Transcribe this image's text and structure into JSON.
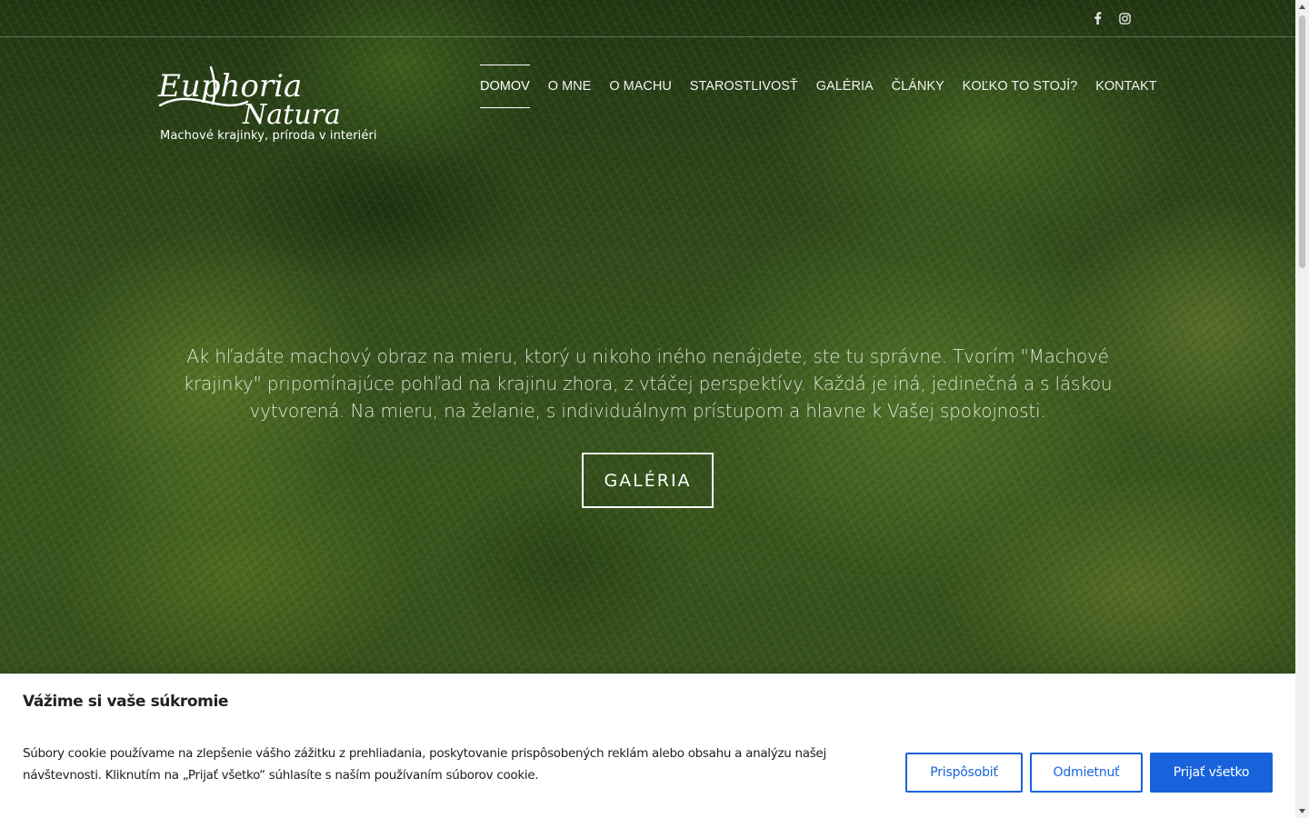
{
  "social": {
    "facebook_icon": "facebook-icon",
    "instagram_icon": "instagram-icon"
  },
  "logo": {
    "line1": "Euphoria",
    "line2": "Natura",
    "tagline": "Machové krajinky, príroda v interiéri"
  },
  "nav": {
    "items": [
      {
        "label": "DOMOV",
        "active": true
      },
      {
        "label": "O MNE",
        "active": false
      },
      {
        "label": "O MACHU",
        "active": false
      },
      {
        "label": "STAROSTLIVOSŤ",
        "active": false
      },
      {
        "label": "GALÉRIA",
        "active": false
      },
      {
        "label": "ČLÁNKY",
        "active": false
      },
      {
        "label": "KOĽKO TO STOJÍ?",
        "active": false
      },
      {
        "label": "KONTAKT",
        "active": false
      }
    ]
  },
  "hero": {
    "text": "Ak hľadáte machový obraz na mieru, ktorý u nikoho iného nenájdete, ste tu správne. Tvorím \"Machové krajinky\" pripomínajúce pohľad na krajinu zhora, z vtáčej perspektívy. Každá je iná, jedinečná a s láskou vytvorená. Na mieru, na želanie, s individuálnym prístupom a hlavne k Vašej spokojnosti.",
    "button_label": "GALÉRIA"
  },
  "cookie": {
    "title": "Vážime si vaše súkromie",
    "text": "Súbory cookie používame na zlepšenie vášho zážitku z prehliadania, poskytovanie prispôsobených reklám alebo obsahu a analýzu našej návštevnosti. Kliknutím na „Prijať všetko“ súhlasíte s naším používaním súborov cookie.",
    "customize_label": "Prispôsobiť",
    "reject_label": "Odmietnuť",
    "accept_label": "Prijať všetko"
  },
  "colors": {
    "accent": "#1863dc",
    "moss_dark": "#2a4317",
    "moss_light": "#7aa33c"
  }
}
